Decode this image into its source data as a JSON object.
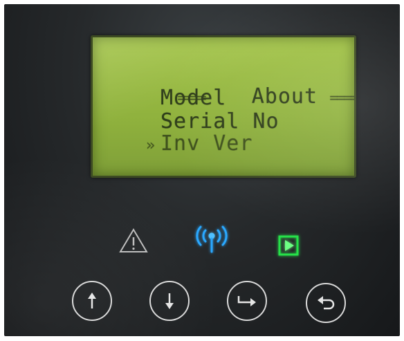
{
  "lcd": {
    "header_left": "====",
    "header_title": "About",
    "header_right": "=====",
    "menu_items": [
      "Model",
      "Serial No",
      "Inv Ver"
    ],
    "cursor_glyph": "»"
  },
  "indicators": {
    "warning": {
      "icon": "warning-triangle-icon",
      "state": "off",
      "color": "#bdbdbd"
    },
    "communication": {
      "icon": "wireless-signal-icon",
      "state": "on",
      "color": "#2aa8ff"
    },
    "run": {
      "icon": "play-icon",
      "state": "on",
      "color": "#27e04a"
    }
  },
  "buttons": [
    {
      "icon": "arrow-up-icon"
    },
    {
      "icon": "arrow-down-icon"
    },
    {
      "icon": "enter-arrow-icon"
    },
    {
      "icon": "back-return-icon"
    }
  ],
  "colors": {
    "lcd_background": "#9dbd45",
    "lcd_text": "#2e3d1a",
    "panel": "#26292b"
  }
}
